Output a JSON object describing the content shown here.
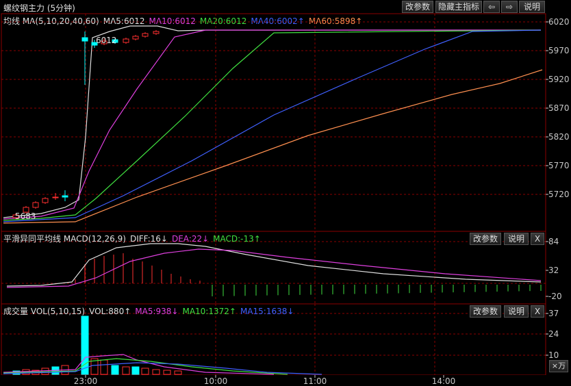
{
  "window": {
    "title": "螺纹钢主力 (5分钟)"
  },
  "toolbar": {
    "params_label": "改参数",
    "hide_indicator_label": "隐藏主指标",
    "prev_arrow": "⇦",
    "next_arrow": "⇨",
    "help_label": "说明"
  },
  "main_panel": {
    "legend": [
      {
        "text": "均线 MA(5,10,20,40,60)",
        "color": "#e0e0e0"
      },
      {
        "text": "MA5:6012",
        "color": "#e0e0e0"
      },
      {
        "text": "MA10:6012",
        "color": "#e040e0"
      },
      {
        "text": "MA20:6012",
        "color": "#40e040"
      },
      {
        "text": "MA40:6002↑",
        "color": "#4060ff"
      },
      {
        "text": "MA60:5898↑",
        "color": "#ff9050"
      }
    ],
    "y_ticks": [
      "6020",
      "5970",
      "5920",
      "5870",
      "5820",
      "5770",
      "5720"
    ],
    "annotations": {
      "low": "5683",
      "high": "6012"
    }
  },
  "macd_panel": {
    "legend": [
      {
        "text": "平滑异同平均线 MACD(12,26,9)",
        "color": "#e0e0e0"
      },
      {
        "text": "DIFF:16↓",
        "color": "#e0e0e0"
      },
      {
        "text": "DEA:22↓",
        "color": "#e040e0"
      },
      {
        "text": "MACD:-13↑",
        "color": "#40e040"
      }
    ],
    "params_label": "改参数",
    "help_label": "说明",
    "close_label": "X",
    "y_ticks": [
      "84",
      "32",
      "-20"
    ]
  },
  "vol_panel": {
    "legend": [
      {
        "text": "成交量 VOL(5,10,15)",
        "color": "#e0e0e0"
      },
      {
        "text": "VOL:880↑",
        "color": "#e0e0e0"
      },
      {
        "text": "MA5:938↓",
        "color": "#e040e0"
      },
      {
        "text": "MA10:1372↑",
        "color": "#40e040"
      },
      {
        "text": "MA15:1638↓",
        "color": "#4060ff"
      }
    ],
    "params_label": "改参数",
    "help_label": "说明",
    "close_label": "X",
    "y_ticks": [
      "37",
      "24",
      "10"
    ],
    "unit_label": "×万"
  },
  "time_axis": {
    "labels": [
      "23:00",
      "10:00",
      "11:00",
      "14:00"
    ]
  },
  "colors": {
    "up": "#ff3030",
    "down": "#00ffff",
    "grid": "#8b0000"
  }
}
